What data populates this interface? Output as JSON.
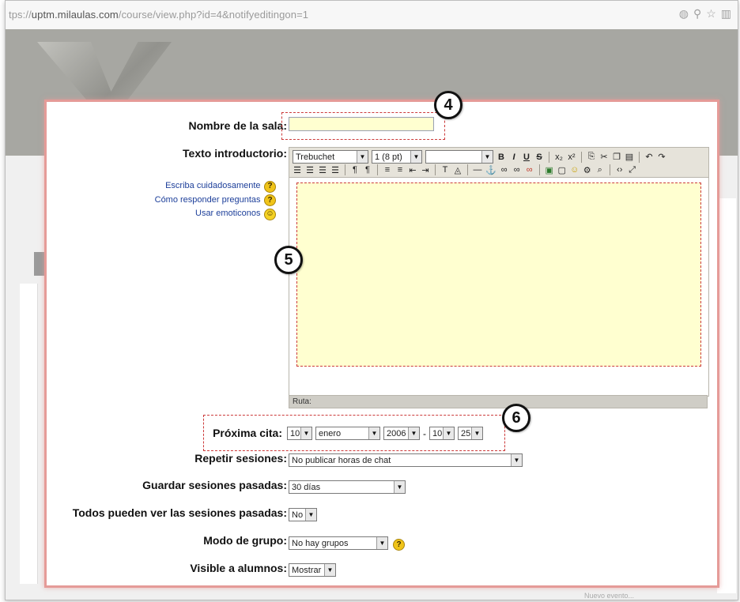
{
  "browser": {
    "url_prefix": "tps://",
    "url_host": "uptm.milaulas.com",
    "url_path": "/course/view.php?id=4&notifyeditingon=1"
  },
  "background": {
    "footer_line1": "",
    "footer_line2": "Nuevo evento..."
  },
  "form": {
    "name_label": "Nombre de la sala:",
    "name_value": "",
    "intro_label": "Texto introductorio:",
    "help_links": [
      "Escriba cuidadosamente",
      "Cómo responder preguntas",
      "Usar emoticonos"
    ],
    "toolbar": {
      "font": "Trebuchet",
      "size": "1 (8 pt)",
      "style": "",
      "format_buttons": [
        "B",
        "I",
        "U",
        "S",
        "x₂",
        "x²"
      ]
    },
    "editor_status": "Ruta:",
    "next_label": "Próxima cita:",
    "next_day": "10",
    "next_month": "enero",
    "next_year": "2006",
    "next_sep": "-",
    "next_hour": "10",
    "next_minute": "25",
    "repeat_label": "Repetir sesiones:",
    "repeat_value": "No publicar horas de chat",
    "keep_label": "Guardar sesiones pasadas:",
    "keep_value": "30 días",
    "everyone_label": "Todos pueden ver las sesiones pasadas:",
    "everyone_value": "No",
    "group_label": "Modo de grupo:",
    "group_value": "No hay grupos",
    "visible_label": "Visible a alumnos:",
    "visible_value": "Mostrar"
  },
  "callouts": [
    "4",
    "5",
    "6"
  ],
  "colors": {
    "dialog_border": "#e59b98",
    "highlight_fill": "#ffffd0",
    "dash": "#cc3a3a"
  }
}
